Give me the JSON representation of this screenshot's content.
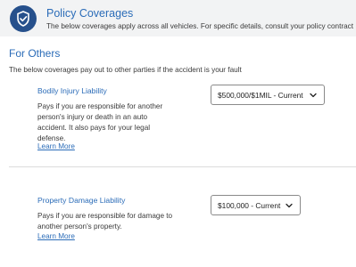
{
  "header": {
    "icon": "shield-check-icon",
    "title": "Policy Coverages",
    "subtitle": "The below coverages apply across all vehicles. For specific details, consult your policy contract"
  },
  "section": {
    "title": "For Others",
    "description": "The below coverages pay out to other parties if the accident is your fault"
  },
  "coverages": [
    {
      "name": "Bodily Injury Liability",
      "description": "Pays if you are responsible for another person's injury or death in an auto accident. It also pays for your legal defense.",
      "learn_more": "Learn More",
      "selected": "$500,000/$1MIL - Current"
    },
    {
      "name": "Property Damage Liability",
      "description": "Pays if you are responsible for damage to another person's property.",
      "learn_more": "Learn More",
      "selected": "$100,000 - Current"
    }
  ],
  "colors": {
    "accent": "#2b6cb8",
    "icon_bg": "#26508c",
    "header_bg": "#f2f3f4"
  }
}
